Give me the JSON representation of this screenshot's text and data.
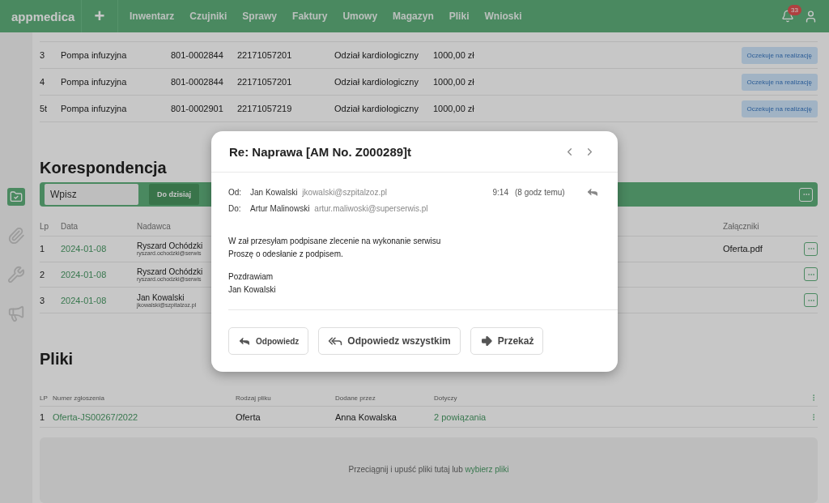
{
  "nav": {
    "logo": "appmedica",
    "add_label": "+",
    "items": [
      "Inwentarz",
      "Czujniki",
      "Sprawy",
      "Faktury",
      "Umowy",
      "Magazyn",
      "Pliki",
      "Wnioski"
    ],
    "notifications_count": "33"
  },
  "sidebar": {
    "items": [
      {
        "kind": "folder",
        "selected": true
      },
      {
        "kind": "paperclip",
        "selected": false
      },
      {
        "kind": "tools",
        "selected": false
      },
      {
        "kind": "megaphone",
        "selected": false
      }
    ]
  },
  "orders": {
    "rows": [
      {
        "lp": "3",
        "name": "Pompa infuzyjna",
        "code": "801-0002844",
        "serial": "22171057201",
        "department": "Odział kardiologiczny",
        "price": "1000,00 zł",
        "status": "Oczekuje na realizację"
      },
      {
        "lp": "4",
        "name": "Pompa infuzyjna",
        "code": "801-0002844",
        "serial": "22171057201",
        "department": "Odział kardiologiczny",
        "price": "1000,00 zł",
        "status": "Oczekuje na realizację"
      },
      {
        "lp": "5t",
        "name": "Pompa infuzyjna",
        "code": "801-0002901",
        "serial": "22171057219",
        "department": "Odział kardiologiczny",
        "price": "1000,00 zł",
        "status": "Oczekuje na realizację"
      }
    ]
  },
  "correspondence": {
    "title": "Korespondencja",
    "search": {
      "placeholder": "Wpisz"
    },
    "filter_button": "Do dzisiaj",
    "columns": [
      "Lp",
      "Data",
      "Nadawca",
      "Załączniki"
    ],
    "rows": [
      {
        "lp": "1",
        "date": "2024-01-08",
        "sender_name": "Ryszard Ochódzki",
        "sender_email": "ryszard.ochodzki@serwis",
        "attachment": "Oferta.pdf"
      },
      {
        "lp": "2",
        "date": "2024-01-08",
        "sender_name": "Ryszard Ochódzki",
        "sender_email": "ryszard.ochodzki@serwis"
      },
      {
        "lp": "3",
        "date": "2024-01-08",
        "sender_name": "Jan Kowalski",
        "sender_email": "jkowalski@szpitalzoz.pl"
      }
    ]
  },
  "files": {
    "title": "Pliki",
    "columns": [
      "LP",
      "Numer zgłoszenia",
      "Rodzaj pliku",
      "Dodane przez",
      "Dotyczy"
    ],
    "rows": [
      {
        "lp": "1",
        "number": "Oferta-JS00267/2022",
        "type": "Oferta",
        "added_by": "Anna Kowalska",
        "related": "2 powiązania"
      }
    ],
    "dropzone": {
      "text": "Przeciągnij i upuść pliki tutaj lub ",
      "link": "wybierz pliki"
    }
  },
  "modal": {
    "title": "Re: Naprawa [AM No. Z000289]t",
    "from": {
      "label": "Od:",
      "name": "Jan Kowalski",
      "email": "jkowalski@szpitalzoz.pl"
    },
    "to": {
      "label": "Do:",
      "name": "Artur Malinowski",
      "email": "artur.maliwoski@superserwis.pl"
    },
    "time": "9:14",
    "ago": "(8 godz temu)",
    "body": [
      [
        "W zał przesyłam podpisane zlecenie na wykonanie serwisu",
        "Proszę o odesłanie z podpisem."
      ],
      [
        "Pozdrawiam",
        "Jan Kowalski"
      ]
    ],
    "buttons": [
      {
        "kind": "reply",
        "label": "Odpowiedz"
      },
      {
        "kind": "reply_all",
        "label": "Odpowiedz wszystkim"
      },
      {
        "kind": "forward",
        "label": "Przekaż"
      }
    ]
  }
}
